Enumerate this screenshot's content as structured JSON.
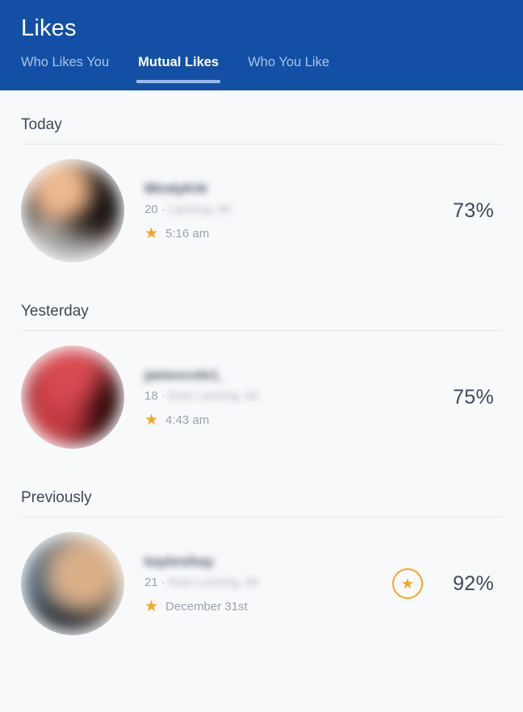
{
  "header": {
    "title": "Likes",
    "accent_color": "#1350a5",
    "underline_color": "#9cb9e8",
    "tabs": [
      {
        "label": "Who Likes You",
        "active": false
      },
      {
        "label": "Mutual Likes",
        "active": true
      },
      {
        "label": "Who You Like",
        "active": false
      }
    ]
  },
  "theme": {
    "background": "#f8f9fb",
    "star_color": "#f5a623",
    "text_color": "#3c4858",
    "muted_color": "#9aa3ad",
    "divider_color": "#e2e5ea"
  },
  "sections": [
    {
      "title": "Today",
      "rows": [
        {
          "username": "MindyKitt",
          "age": "20",
          "separator": "·",
          "location": "Lansing, MI",
          "star_icon": "star-icon",
          "timestamp": "5:16 am",
          "percent": "73%",
          "has_badge": false,
          "avatar": "av1"
        }
      ]
    },
    {
      "title": "Yesterday",
      "rows": [
        {
          "username": "jamescole1_",
          "age": "18",
          "separator": "·",
          "location": "East Lansing, MI",
          "star_icon": "star-icon",
          "timestamp": "4:43 am",
          "percent": "75%",
          "has_badge": false,
          "avatar": "av2"
        }
      ]
    },
    {
      "title": "Previously",
      "rows": [
        {
          "username": "kaylesihay",
          "age": "21",
          "separator": "·",
          "location": "East Lansing, MI",
          "star_icon": "star-icon",
          "timestamp": "December 31st",
          "percent": "92%",
          "has_badge": true,
          "badge_icon": "star-badge-icon",
          "avatar": "av3"
        }
      ]
    }
  ]
}
